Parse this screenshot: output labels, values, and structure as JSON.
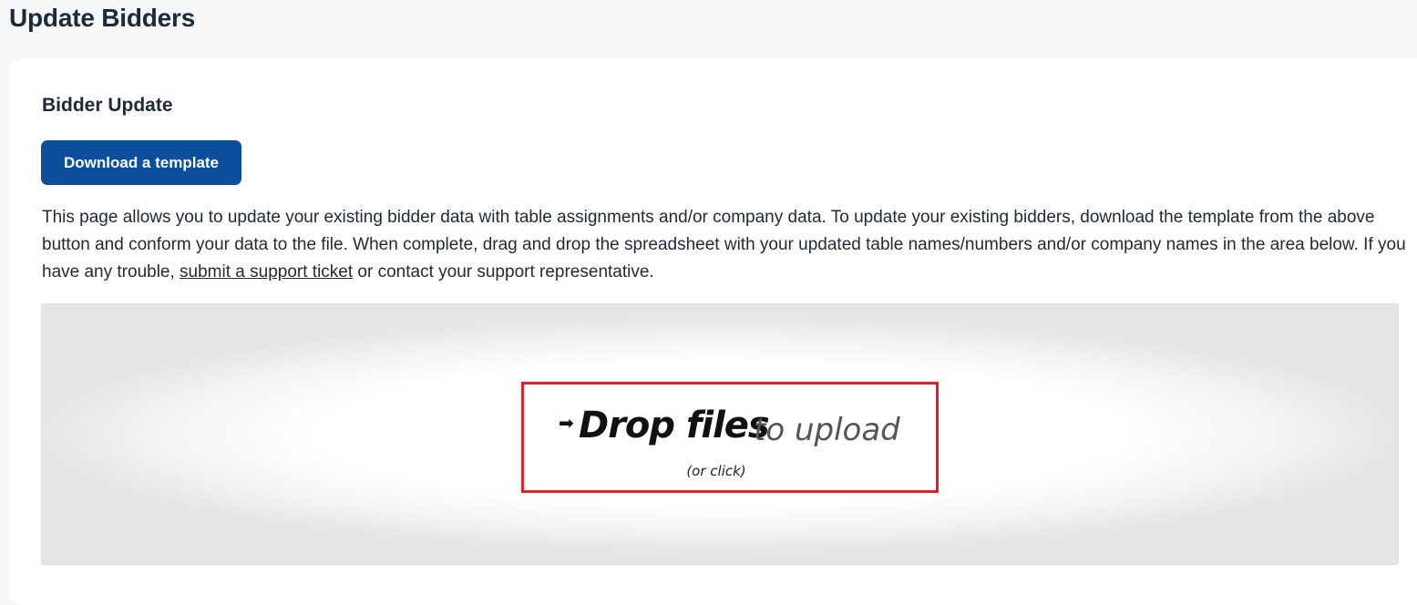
{
  "page": {
    "title": "Update Bidders"
  },
  "section": {
    "title": "Bidder Update",
    "download_button_label": "Download a template",
    "description_part1": "This page allows you to update your existing bidder data with table assignments and/or company data. To update your existing bidders, download the template from the above button and conform your data to the file. When complete, drag and drop the spreadsheet with your updated table names/numbers and/or company names in the area below. If you have any trouble, ",
    "support_link_label": "submit a support ticket",
    "description_part2": " or contact your support representative."
  },
  "dropzone": {
    "main_label": "Drop files",
    "sub_label": "to upload",
    "click_hint": "(or click)",
    "arrow_icon": "arrow-right-icon",
    "highlight_color": "#e2202a"
  },
  "colors": {
    "primary_button": "#0b4f9c",
    "page_background": "#f7f8fa"
  }
}
